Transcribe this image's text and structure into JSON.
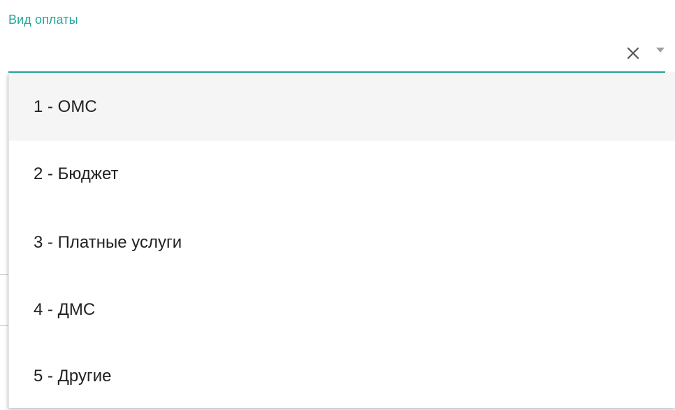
{
  "field": {
    "label": "Вид оплаты",
    "value": "",
    "accent_color": "#26a69a"
  },
  "icons": {
    "clear": "close-icon",
    "dropdown": "caret-down-icon"
  },
  "menu": {
    "items": [
      {
        "label": "1 - ОМС",
        "highlighted": true
      },
      {
        "label": "2 - Бюджет",
        "highlighted": false
      },
      {
        "label": "3 - Платные услуги",
        "highlighted": false
      },
      {
        "label": "4 - ДМС",
        "highlighted": false
      },
      {
        "label": "5 - Другие",
        "highlighted": false
      }
    ]
  }
}
